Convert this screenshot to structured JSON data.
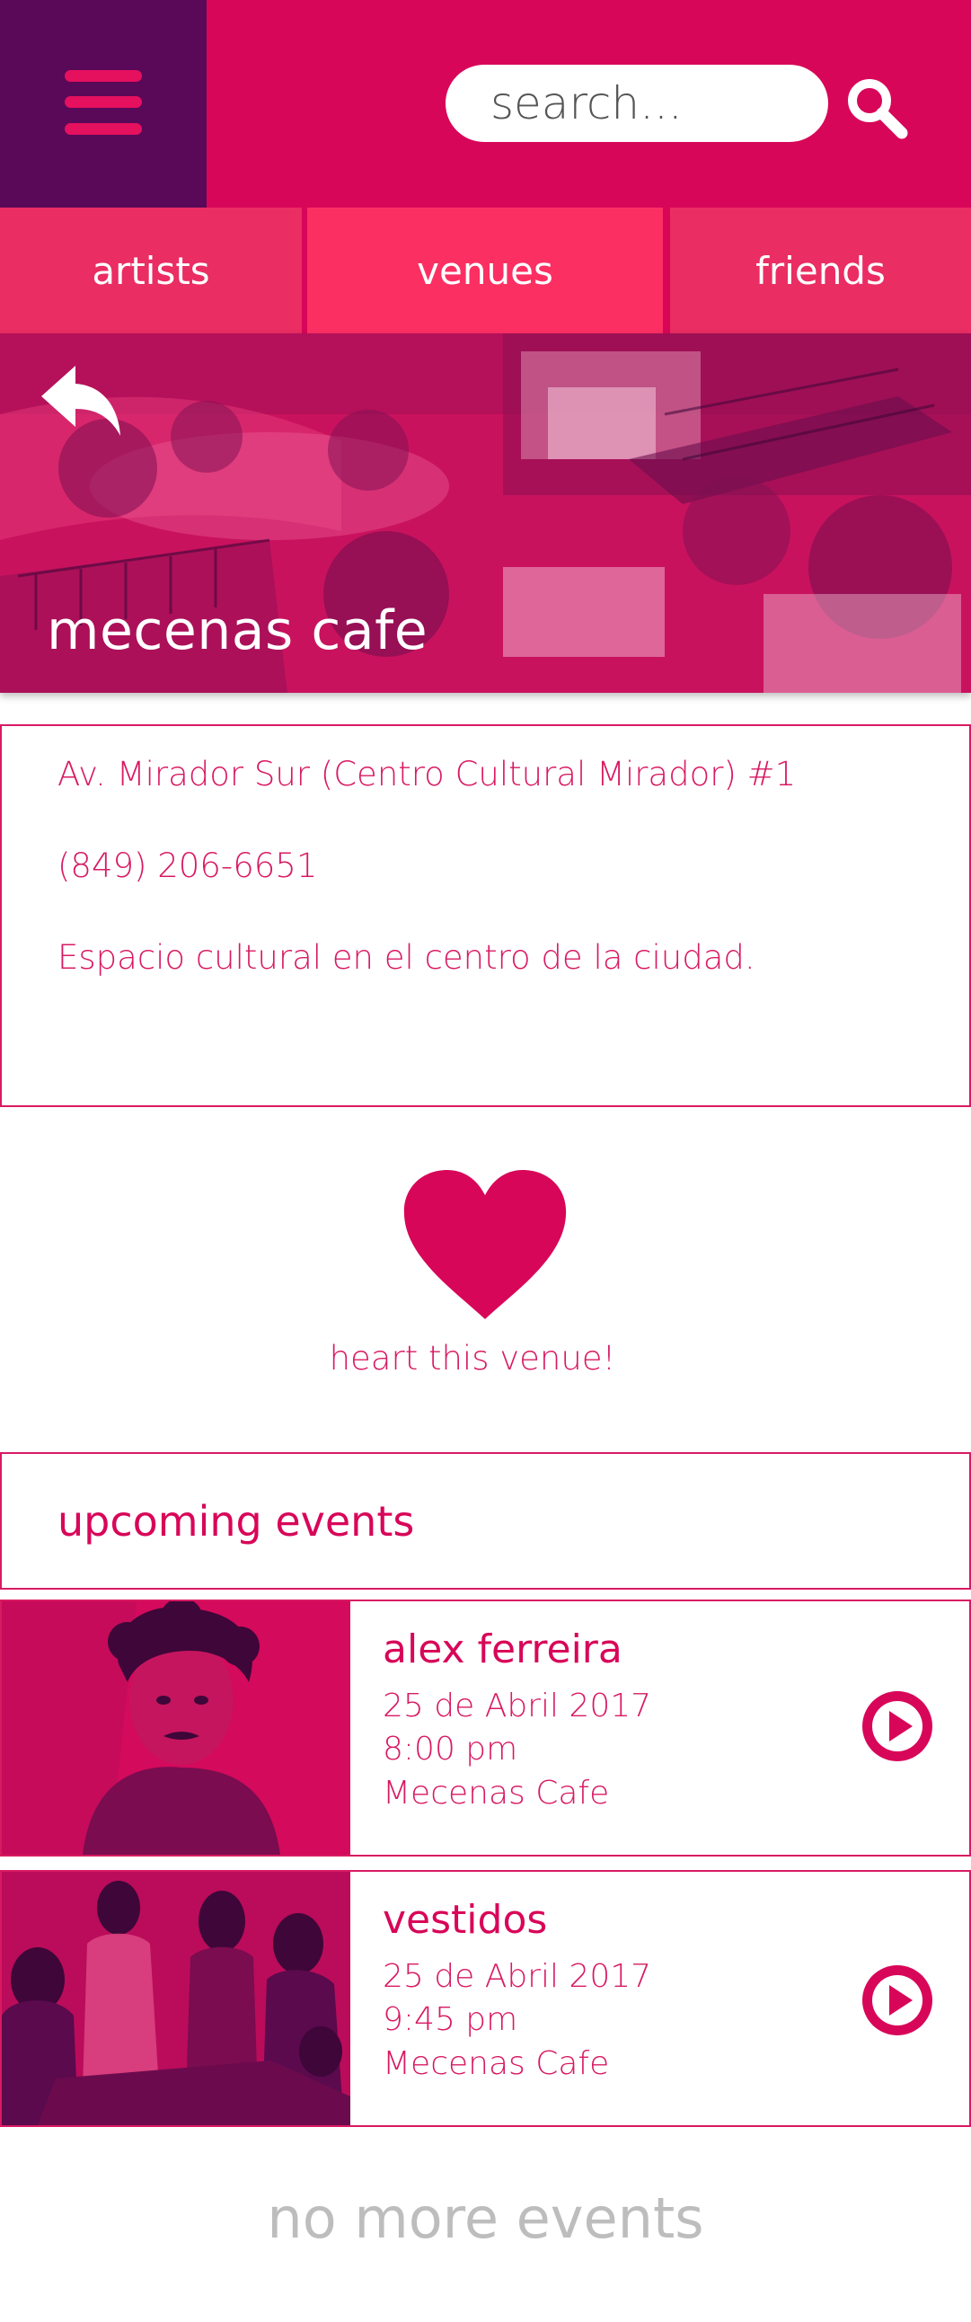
{
  "header": {
    "search_placeholder": "search..."
  },
  "tabs": [
    {
      "label": "artists"
    },
    {
      "label": "venues"
    },
    {
      "label": "friends"
    }
  ],
  "venue": {
    "name": "mecenas cafe",
    "address": "Av. Mirador Sur (Centro Cultural Mirador) #1",
    "phone": "(849) 206-6651",
    "description": "Espacio cultural en el centro de la ciudad."
  },
  "heart": {
    "label": "heart this venue!"
  },
  "upcoming": {
    "title": "upcoming events",
    "events": [
      {
        "name": "alex ferreira",
        "date": "25 de Abril 2017",
        "time": "8:00 pm",
        "venue": "Mecenas Cafe"
      },
      {
        "name": "vestidos",
        "date": "25 de Abril 2017",
        "time": "9:45 pm",
        "venue": "Mecenas Cafe"
      }
    ],
    "end_text": "no more events"
  },
  "colors": {
    "primary": "#d80659",
    "menu_bg": "#5a0858",
    "tab_bg": "#ea2d62",
    "tab_active_bg": "#fc2f63",
    "muted": "#bdbdbd"
  },
  "icons": {
    "menu": "hamburger-icon",
    "search": "search-icon",
    "back": "back-arrow-icon",
    "heart": "heart-icon",
    "play": "play-icon"
  }
}
